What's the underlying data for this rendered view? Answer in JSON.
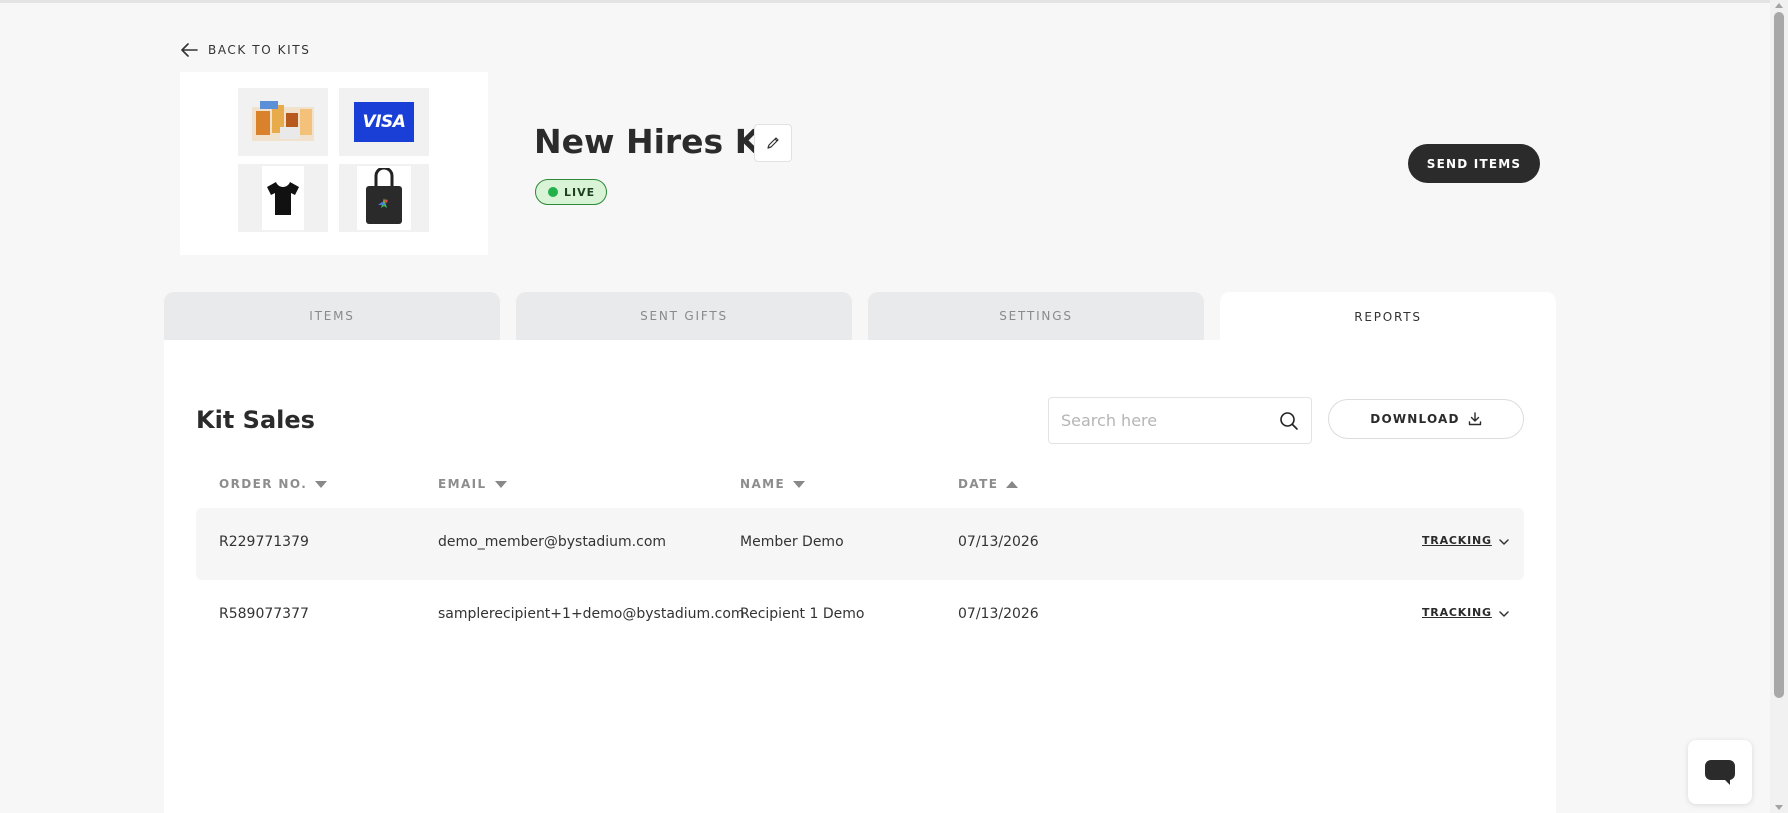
{
  "header": {
    "back_label": "BACK TO KITS",
    "kit_title": "New Hires Kit",
    "status_badge": "LIVE",
    "send_button": "SEND ITEMS",
    "visa_text": "VISA"
  },
  "tabs": [
    {
      "label": "ITEMS",
      "active": false
    },
    {
      "label": "SENT GIFTS",
      "active": false
    },
    {
      "label": "SETTINGS",
      "active": false
    },
    {
      "label": "REPORTS",
      "active": true
    }
  ],
  "report": {
    "title": "Kit Sales",
    "search_placeholder": "Search here",
    "download_label": "DOWNLOAD",
    "columns": [
      {
        "label": "ORDER NO.",
        "sort": "desc"
      },
      {
        "label": "EMAIL",
        "sort": "desc"
      },
      {
        "label": "NAME",
        "sort": "desc"
      },
      {
        "label": "DATE",
        "sort": "asc"
      }
    ],
    "rows": [
      {
        "order_no": "R229771379",
        "email": "demo_member@bystadium.com",
        "name": "Member Demo",
        "date": "07/13/2026",
        "action": "TRACKING"
      },
      {
        "order_no": "R589077377",
        "email": "samplerecipient+1+demo@bystadium.com",
        "name": "Recipient 1 Demo",
        "date": "07/13/2026",
        "action": "TRACKING"
      }
    ]
  },
  "colors": {
    "primary_dark": "#2b2b2b",
    "live_green": "#22b14c",
    "visa_blue": "#1a3fd6"
  }
}
